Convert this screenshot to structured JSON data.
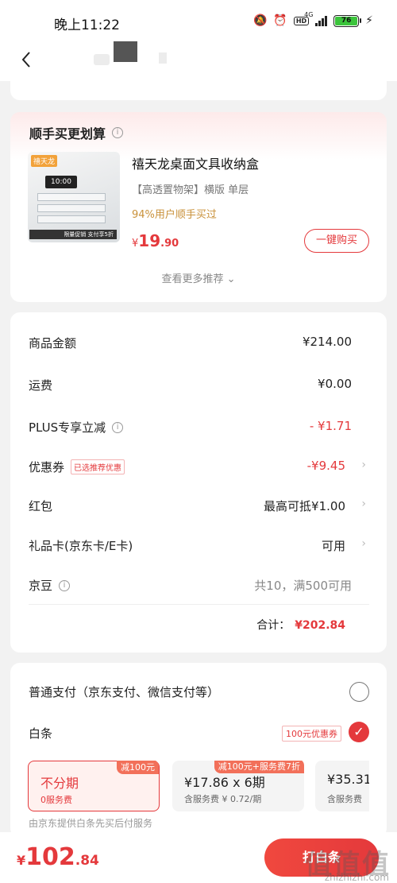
{
  "status_bar": {
    "time": "晚上11:22",
    "network": "4G",
    "battery": "76"
  },
  "nav": {
    "back_icon": "chevron-left-icon"
  },
  "recommend": {
    "title": "顺手买更划算",
    "info_icon": "ⓘ",
    "product": {
      "name": "禧天龙桌面文具收纳盒",
      "spec": "【高透置物架】横版 单层",
      "rate": "94%用户顺手买过",
      "price_currency": "¥",
      "price_int": "19",
      "price_dec": ".90",
      "buy_label": "一键购买",
      "image": {
        "brand": "禧天龙",
        "clock": "10:00",
        "badge": "限量促销 支付享5折"
      }
    },
    "more_label": "查看更多推荐 ⌄"
  },
  "summary": {
    "rows": [
      {
        "label": "商品金额",
        "value": "¥214.00"
      },
      {
        "label": "运费",
        "value": "¥0.00"
      },
      {
        "label": "PLUS专享立减",
        "value": "- ¥1.71"
      },
      {
        "label": "优惠券",
        "tag": "已选推荐优惠",
        "value": "-¥9.45"
      },
      {
        "label": "红包",
        "value": "最高可抵¥1.00"
      },
      {
        "label": "礼品卡(京东卡/E卡)",
        "value": "可用"
      },
      {
        "label": "京豆",
        "value": "共10，满500可用"
      }
    ],
    "total_label": "合计：",
    "total_amount": "¥202.84"
  },
  "payment": {
    "normal_label": "普通支付（京东支付、微信支付等）",
    "baitiao_label": "白条",
    "coupon_tag": "100元优惠券",
    "plans": [
      {
        "ribbon": "减100元",
        "main": "不分期",
        "sub": "0服务费"
      },
      {
        "ribbon": "减100元+服务费7折",
        "main": "¥17.86 x 6期",
        "sub": "含服务费 ¥ 0.72/期"
      },
      {
        "ribbon": "",
        "main": "¥35.31",
        "sub": "含服务费"
      }
    ],
    "note": "由京东提供白条先买后付服务"
  },
  "bottom": {
    "price_currency": "¥",
    "price_int": "102",
    "price_dec": ".84",
    "pay_label": "打白条",
    "watermark": "值值值",
    "watermark_url": "zhizhizhi.com"
  },
  "colors": {
    "accent": "#e4393c",
    "gold": "#c9913a"
  }
}
